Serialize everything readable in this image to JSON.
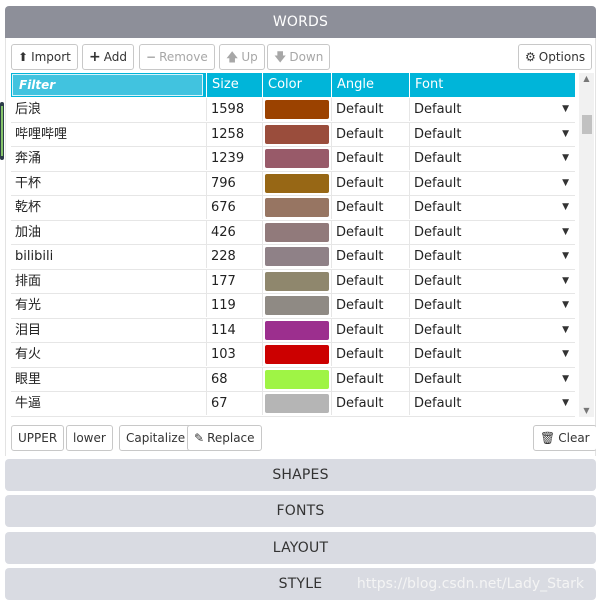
{
  "panels": {
    "words": "WORDS",
    "shapes": "SHAPES",
    "fonts": "FONTS",
    "layout": "LAYOUT",
    "style": "STYLE"
  },
  "toolbar": {
    "import": {
      "icon": "upload-icon",
      "glyph": "⬆",
      "label": "Import"
    },
    "add": {
      "icon": "plus-icon",
      "glyph": "+",
      "label": "Add"
    },
    "remove": {
      "icon": "minus-icon",
      "glyph": "−",
      "label": "Remove"
    },
    "up": {
      "icon": "arrow-up-icon",
      "glyph": "🡅",
      "label": "Up"
    },
    "down": {
      "icon": "arrow-down-icon",
      "glyph": "🡇",
      "label": "Down"
    },
    "options": {
      "icon": "gear-icon",
      "glyph": "⚙",
      "label": "Options"
    }
  },
  "grid": {
    "filter_label": "Filter",
    "columns": [
      "Size",
      "Color",
      "Angle",
      "Font"
    ],
    "rows": [
      {
        "word": "后浪",
        "size": "1598",
        "color": "#9b4200",
        "angle": "Default",
        "font": "Default"
      },
      {
        "word": "哔哩哔哩",
        "size": "1258",
        "color": "#9a4d3c",
        "angle": "Default",
        "font": "Default"
      },
      {
        "word": "奔涌",
        "size": "1239",
        "color": "#985a69",
        "angle": "Default",
        "font": "Default"
      },
      {
        "word": "干杯",
        "size": "796",
        "color": "#976715",
        "angle": "Default",
        "font": "Default"
      },
      {
        "word": "乾杯",
        "size": "676",
        "color": "#977562",
        "angle": "Default",
        "font": "Default"
      },
      {
        "word": "加油",
        "size": "426",
        "color": "#917a7b",
        "angle": "Default",
        "font": "Default"
      },
      {
        "word": "bilibili",
        "size": "228",
        "color": "#8f8187",
        "angle": "Default",
        "font": "Default"
      },
      {
        "word": "排面",
        "size": "177",
        "color": "#8f876d",
        "angle": "Default",
        "font": "Default"
      },
      {
        "word": "有光",
        "size": "119",
        "color": "#8f8a84",
        "angle": "Default",
        "font": "Default"
      },
      {
        "word": "泪目",
        "size": "114",
        "color": "#9c2f8e",
        "angle": "Default",
        "font": "Default"
      },
      {
        "word": "有火",
        "size": "103",
        "color": "#cc0000",
        "angle": "Default",
        "font": "Default"
      },
      {
        "word": "眼里",
        "size": "68",
        "color": "#9ff445",
        "angle": "Default",
        "font": "Default"
      },
      {
        "word": "牛逼",
        "size": "67",
        "color": "#b5b5b5",
        "angle": "Default",
        "font": "Default"
      }
    ],
    "dropdown_glyph": "▼"
  },
  "bottom_bar": {
    "upper": "UPPER",
    "lower": "lower",
    "capitalize": "Capitalize",
    "replace": {
      "icon": "edit-icon",
      "glyph": "✎",
      "label": "Replace"
    },
    "clear": {
      "icon": "trash-icon",
      "glyph": "🗑",
      "label": "Clear"
    }
  },
  "watermark": "https://blog.csdn.net/Lady_Stark",
  "colors": {
    "header_active": "#8d8f99",
    "header_inactive": "#d9dbe2",
    "grid_header": "#00b5d9"
  }
}
